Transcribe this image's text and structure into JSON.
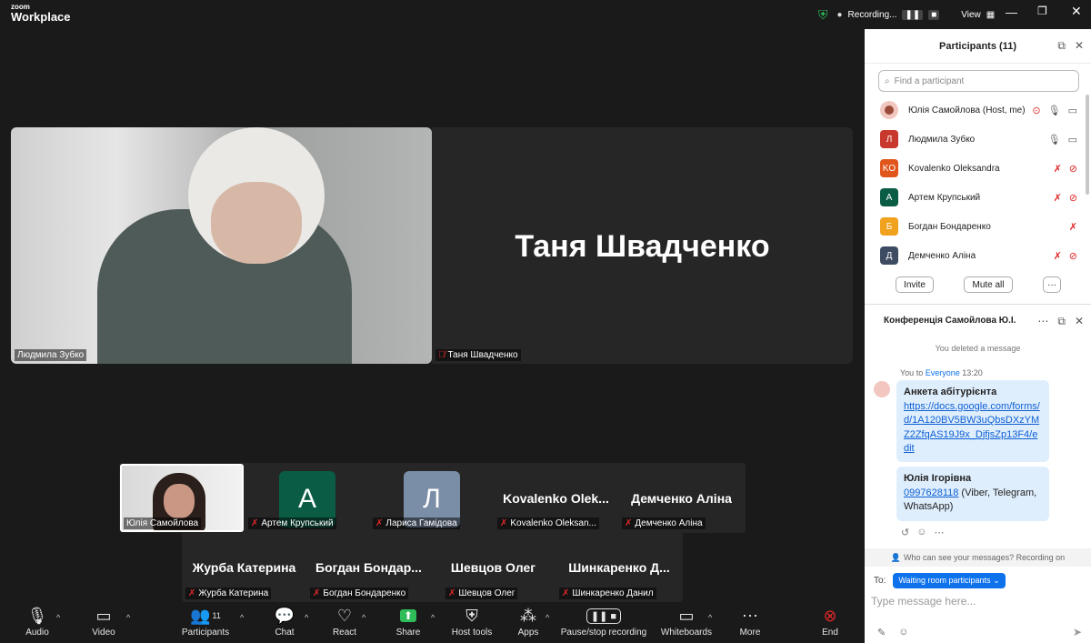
{
  "app": {
    "logo_top": "zoom",
    "logo_bottom": "Workplace",
    "recording_label": "Recording...",
    "view_label": "View"
  },
  "tiles": {
    "speaker1_name": "Людмила Зубко",
    "speaker2_name": "Таня Швадченко",
    "speaker2_big": "Таня Швадченко"
  },
  "strip": [
    {
      "label": "Юлія Самойлова",
      "type": "video"
    },
    {
      "label": "Артем Крупський",
      "big": "А",
      "color": "#0a5c45"
    },
    {
      "label": "Лариса Гамідова",
      "big": "Л",
      "color": "#7b8ea8"
    },
    {
      "label": "Kovalenko Oleksan...",
      "big": "Kovalenko  Olek..."
    },
    {
      "label": "Демченко Аліна",
      "big": "Демченко Аліна"
    },
    {
      "label": "Журба Катерина",
      "big": "Журба Катерина"
    },
    {
      "label": "Богдан Бондаренко",
      "big": "Богдан  Бондар..."
    },
    {
      "label": "Шевцов Олег",
      "big": "Шевцов Олег"
    },
    {
      "label": "Шинкаренко Данил",
      "big": "Шинкаренко  Д..."
    }
  ],
  "toolbar": {
    "audio": "Audio",
    "video": "Video",
    "participants": "Participants",
    "participants_count": "11",
    "chat": "Chat",
    "react": "React",
    "share": "Share",
    "host_tools": "Host tools",
    "apps": "Apps",
    "recording": "Pause/stop recording",
    "whiteboards": "Whiteboards",
    "more": "More",
    "end": "End"
  },
  "participants_panel": {
    "title": "Participants (11)",
    "search_placeholder": "Find a participant",
    "list": [
      {
        "name": "Юлія Самойлова (Host, me)",
        "initials": "",
        "color": "#f2c7c0"
      },
      {
        "name": "Людмила Зубко",
        "initials": "Л",
        "color": "#c8382c"
      },
      {
        "name": "Kovalenko Oleksandra",
        "initials": "KO",
        "color": "#e0561b"
      },
      {
        "name": "Артем Крупський",
        "initials": "А",
        "color": "#0a5c45"
      },
      {
        "name": "Богдан Бондаренко",
        "initials": "Б",
        "color": "#f0a11e"
      },
      {
        "name": "Демченко Аліна",
        "initials": "Д",
        "color": "#3d4c63"
      }
    ],
    "invite": "Invite",
    "mute_all": "Mute all",
    "more": "···"
  },
  "chat": {
    "title": "Конференція Самойлова Ю.І.",
    "system": "You deleted a message",
    "meta_prefix": "You to",
    "meta_target": "Everyone",
    "meta_time": "13:20",
    "msg1_title": "Анкета абітурієнта",
    "msg1_link": "https://docs.google.com/forms/d/1A120BV5BW3uQbsDXzYMZ2ZfqAS19J9x_DjfjsZp13F4/edit",
    "msg2_title": "Юлія Ігорівна",
    "msg2_phone": "0997628118",
    "msg2_rest": " (Viber, Telegram, WhatsApp)",
    "who_can_see": "Who can see your messages? Recording on",
    "to_label": "To:",
    "to_value": "Waiting room participants",
    "input_placeholder": "Type message here..."
  }
}
